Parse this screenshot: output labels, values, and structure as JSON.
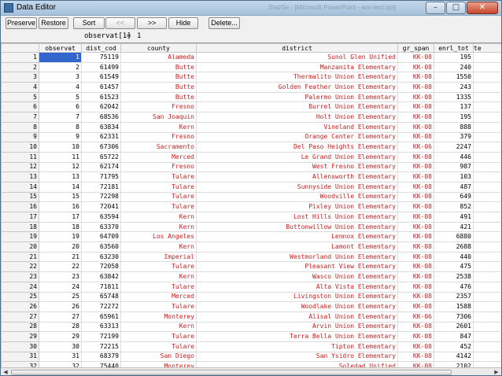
{
  "window": {
    "title": "Data Editor",
    "title_right_text": "Stat/Se - [Microsoft PowerPoint - ann-lect.ppt]",
    "buttons": {
      "minimize": "–",
      "maximize": "□",
      "close": "✕"
    }
  },
  "toolbar": {
    "preserve": "Preserve",
    "restore": "Restore",
    "sort": "Sort",
    "prev": "<<",
    "next": ">>",
    "hide": "Hide",
    "delete": "Delete..."
  },
  "cellbar": {
    "ref": "observat[1]",
    "eq": "=",
    "value": "1"
  },
  "columns": [
    "observat",
    "dist_cod",
    "county",
    "district",
    "gr_span",
    "enrl_tot",
    "te"
  ],
  "rows": [
    [
      "1",
      "1",
      "75119",
      "Alameda",
      "Sunol Glen Unified",
      "KK-08",
      "195"
    ],
    [
      "2",
      "2",
      "61499",
      "Butte",
      "Manzanita Elementary",
      "KK-08",
      "240"
    ],
    [
      "3",
      "3",
      "61549",
      "Butte",
      "Thermalito Union Elementary",
      "KK-08",
      "1550"
    ],
    [
      "4",
      "4",
      "61457",
      "Butte",
      "Golden Feather Union Elementary",
      "KK-08",
      "243"
    ],
    [
      "5",
      "5",
      "61523",
      "Butte",
      "Palermo Union Elementary",
      "KK-08",
      "1335"
    ],
    [
      "6",
      "6",
      "62042",
      "Fresno",
      "Burrel Union Elementary",
      "KK-08",
      "137"
    ],
    [
      "7",
      "7",
      "68536",
      "San Joaquin",
      "Holt Union Elementary",
      "KK-08",
      "195"
    ],
    [
      "8",
      "8",
      "63834",
      "Kern",
      "Vineland Elementary",
      "KK-08",
      "888"
    ],
    [
      "9",
      "9",
      "62331",
      "Fresno",
      "Orange Center Elementary",
      "KK-08",
      "379"
    ],
    [
      "10",
      "10",
      "67306",
      "Sacramento",
      "Del Paso Heights Elementary",
      "KK-06",
      "2247"
    ],
    [
      "11",
      "11",
      "65722",
      "Merced",
      "Le Grand Union Elementary",
      "KK-08",
      "446"
    ],
    [
      "12",
      "12",
      "62174",
      "Fresno",
      "West Fresno Elementary",
      "KK-08",
      "987"
    ],
    [
      "13",
      "13",
      "71795",
      "Tulare",
      "Allensworth Elementary",
      "KK-08",
      "103"
    ],
    [
      "14",
      "14",
      "72181",
      "Tulare",
      "Sunnyside Union Elementary",
      "KK-08",
      "487"
    ],
    [
      "15",
      "15",
      "72298",
      "Tulare",
      "Woodville Elementary",
      "KK-08",
      "649"
    ],
    [
      "16",
      "16",
      "72041",
      "Tulare",
      "Pixley Union Elementary",
      "KK-08",
      "852"
    ],
    [
      "17",
      "17",
      "63594",
      "Kern",
      "Lost Hills Union Elementary",
      "KK-08",
      "491"
    ],
    [
      "18",
      "18",
      "63370",
      "Kern",
      "Buttonwillow Union Elementary",
      "KK-08",
      "421"
    ],
    [
      "19",
      "19",
      "64709",
      "Los Angeles",
      "Lennox Elementary",
      "KK-08",
      "6880"
    ],
    [
      "20",
      "20",
      "63560",
      "Kern",
      "Lamont Elementary",
      "KK-08",
      "2688"
    ],
    [
      "21",
      "21",
      "63230",
      "Imperial",
      "Westmorland Union Elementary",
      "KK-08",
      "440"
    ],
    [
      "22",
      "22",
      "72058",
      "Tulare",
      "Pleasant View Elementary",
      "KK-08",
      "475"
    ],
    [
      "23",
      "23",
      "63842",
      "Kern",
      "Wasco Union Elementary",
      "KK-08",
      "2538"
    ],
    [
      "24",
      "24",
      "71811",
      "Tulare",
      "Alta Vista Elementary",
      "KK-08",
      "476"
    ],
    [
      "25",
      "25",
      "65748",
      "Merced",
      "Livingston Union Elementary",
      "KK-08",
      "2357"
    ],
    [
      "26",
      "26",
      "72272",
      "Tulare",
      "Woodlake Union Elementary",
      "KK-08",
      "1588"
    ],
    [
      "27",
      "27",
      "65961",
      "Monterey",
      "Alisal Union Elementary",
      "KK-06",
      "7306"
    ],
    [
      "28",
      "28",
      "63313",
      "Kern",
      "Arvin Union Elementary",
      "KK-08",
      "2601"
    ],
    [
      "29",
      "29",
      "72199",
      "Tulare",
      "Terra Bella Union Elementary",
      "KK-08",
      "847"
    ],
    [
      "30",
      "30",
      "72215",
      "Tulare",
      "Tipton Elementary",
      "KK-08",
      "452"
    ],
    [
      "31",
      "31",
      "68379",
      "San Diego",
      "San Ysidro Elementary",
      "KK-08",
      "4142"
    ],
    [
      "32",
      "32",
      "75440",
      "Monterey",
      "Soledad Unified",
      "KK-08",
      "2102"
    ]
  ]
}
